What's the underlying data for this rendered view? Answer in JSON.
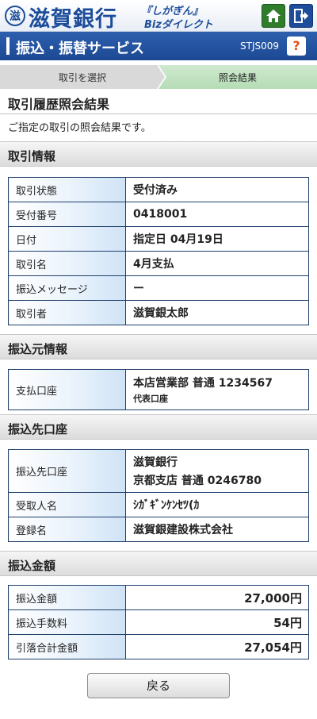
{
  "header": {
    "logo_glyph": "滋",
    "bank_name": "滋賀銀行",
    "brand_line1": "『しがぎん』",
    "brand_line2": "Bizダイレクト"
  },
  "titlebar": {
    "title": "振込・振替サービス",
    "screen_code": "STJS009",
    "help_label": "?"
  },
  "steps": [
    "取引を選択",
    "照会結果"
  ],
  "page_heading": "取引履歴照会結果",
  "intro": "ご指定の取引の照会結果です。",
  "sections": {
    "transaction_info": {
      "heading": "取引情報",
      "rows": [
        {
          "label": "取引状態",
          "value": "受付済み"
        },
        {
          "label": "受付番号",
          "value": "0418001"
        },
        {
          "label": "日付",
          "value": "指定日 04月19日"
        },
        {
          "label": "取引名",
          "value": "4月支払"
        },
        {
          "label": "振込メッセージ",
          "value": "ー"
        },
        {
          "label": "取引者",
          "value": "滋賀銀太郎"
        }
      ]
    },
    "source_info": {
      "heading": "振込元情報",
      "rows": [
        {
          "label": "支払口座",
          "value": "本店営業部 普通 1234567",
          "sub": "代表口座"
        }
      ]
    },
    "destination": {
      "heading": "振込先口座",
      "rows": [
        {
          "label": "振込先口座",
          "value": "滋賀銀行",
          "value2": "京都支店 普通 0246780"
        },
        {
          "label": "受取人名",
          "value": "ｼｶﾞｷﾞﾝｹﾝｾﾂ(ｶ"
        },
        {
          "label": "登録名",
          "value": "滋賀銀建設株式会社"
        }
      ]
    },
    "amount": {
      "heading": "振込金額",
      "rows": [
        {
          "label": "振込金額",
          "value": "27,000円"
        },
        {
          "label": "振込手数料",
          "value": "54円"
        },
        {
          "label": "引落合計金額",
          "value": "27,054円"
        }
      ]
    }
  },
  "back_button": "戻る",
  "colors": {
    "brand_blue": "#1d4d9a",
    "home_green": "#2f7d2c",
    "help_orange": "#e0531b",
    "table_border": "#1f3f6a"
  },
  "icons": {
    "home": "home-icon",
    "logout": "logout-icon"
  }
}
